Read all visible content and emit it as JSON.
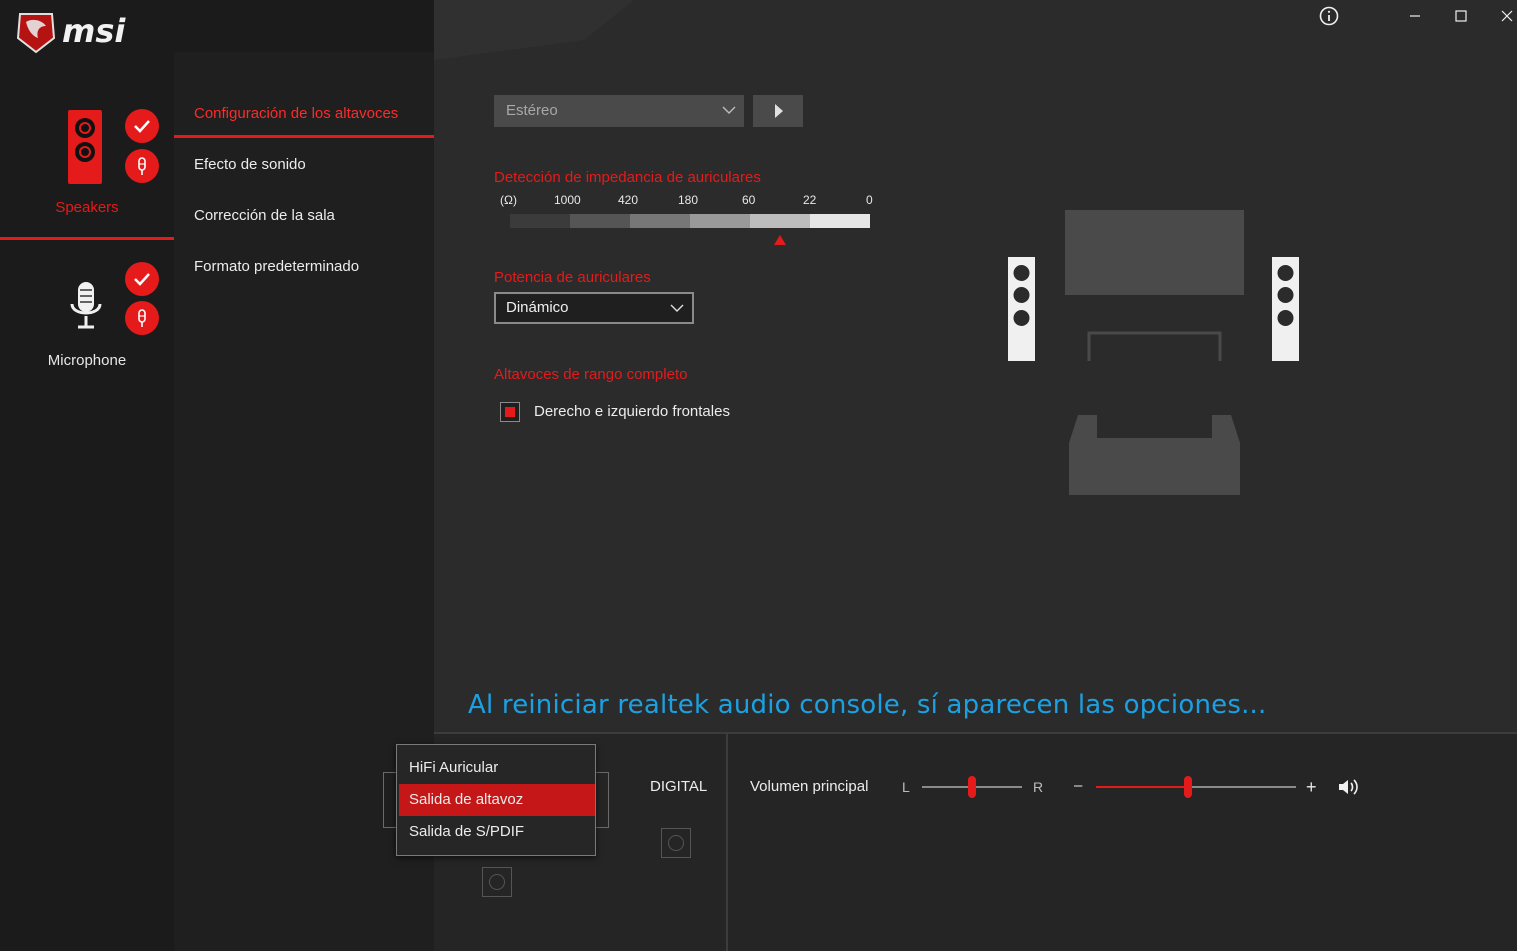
{
  "brand": {
    "name": "msi"
  },
  "window": {
    "info_icon": "info-circle-icon",
    "minimize_icon": "minimize-icon",
    "maximize_icon": "maximize-icon",
    "close_icon": "close-icon"
  },
  "devices": [
    {
      "label": "Speakers",
      "active": true,
      "icon": "speaker-icon"
    },
    {
      "label": "Microphone",
      "active": false,
      "icon": "microphone-icon"
    }
  ],
  "menu": {
    "items": [
      {
        "label": "Configuración de los altavoces",
        "active": true
      },
      {
        "label": "Efecto de sonido",
        "active": false
      },
      {
        "label": "Corrección de la sala",
        "active": false
      },
      {
        "label": "Formato predeterminado",
        "active": false
      }
    ]
  },
  "config": {
    "speaker_mode": "Estéreo",
    "play_icon": "play-icon",
    "impedance": {
      "heading": "Detección de impedancia de auriculares",
      "unit": "(Ω)",
      "ticks": [
        "1000",
        "420",
        "180",
        "60",
        "22",
        "0"
      ],
      "marker_level": 0.75
    },
    "power": {
      "heading": "Potencia de auriculares",
      "value": "Dinámico"
    },
    "fullrange": {
      "heading": "Altavoces de rango completo",
      "checkbox_label": "Derecho e izquierdo frontales",
      "checked": true
    }
  },
  "caption": "Al reiniciar realtek audio console, sí aparecen las opciones...",
  "bottom": {
    "popup_items": [
      "HiFi Auricular",
      "Salida de altavoz",
      "Salida de S/PDIF"
    ],
    "popup_selected": "Salida de altavoz",
    "digital_label": "DIGITAL",
    "volume_label": "Volumen principal",
    "balance_left": "L",
    "balance_right": "R",
    "balance_level": 0.5,
    "volume_minus": "–",
    "volume_plus": "+",
    "volume_level": 0.46,
    "volume_icon": "volume-icon"
  },
  "colors": {
    "accent": "#e51b1b",
    "caption": "#1ba1e2"
  }
}
